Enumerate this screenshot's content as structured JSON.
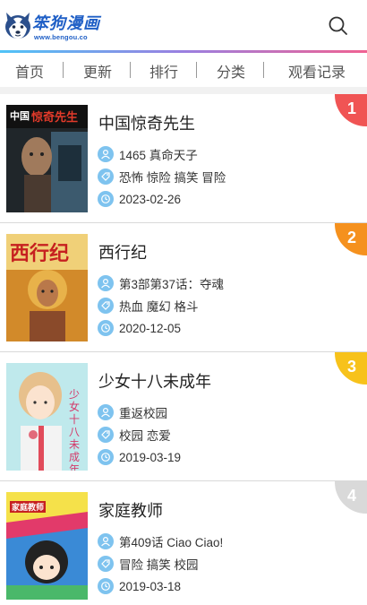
{
  "header": {
    "logo_title": "笨狗漫画",
    "logo_url": "www.bengou.co"
  },
  "nav": [
    "首页",
    "更新",
    "排行",
    "分类",
    "观看记录"
  ],
  "comics": [
    {
      "rank": "1",
      "title": "中国惊奇先生",
      "latest": "1465 真命天子",
      "tags": "恐怖 惊险 搞笑 冒险",
      "date": "2023-02-26",
      "rank_color": "#f05454",
      "cover_text": "惊奇先生"
    },
    {
      "rank": "2",
      "title": "西行纪",
      "latest": "第3部第37话：夺魂",
      "tags": "热血 魔幻 格斗",
      "date": "2020-12-05",
      "rank_color": "#f5911e",
      "cover_text": "西行纪"
    },
    {
      "rank": "3",
      "title": "少女十八未成年",
      "latest": "重返校园",
      "tags": "校园 恋爱",
      "date": "2019-03-19",
      "rank_color": "#f7c21b",
      "cover_text": "少女十八未成年"
    },
    {
      "rank": "4",
      "title": "家庭教师",
      "latest": "第409话 Ciao Ciao!",
      "tags": "冒险 搞笑 校园",
      "date": "2019-03-18",
      "rank_color": "#d9d9d9",
      "cover_text": "家庭教师"
    }
  ],
  "icons": {
    "search": "search-icon",
    "latest": "person-icon",
    "tags": "tag-icon",
    "date": "clock-icon"
  }
}
